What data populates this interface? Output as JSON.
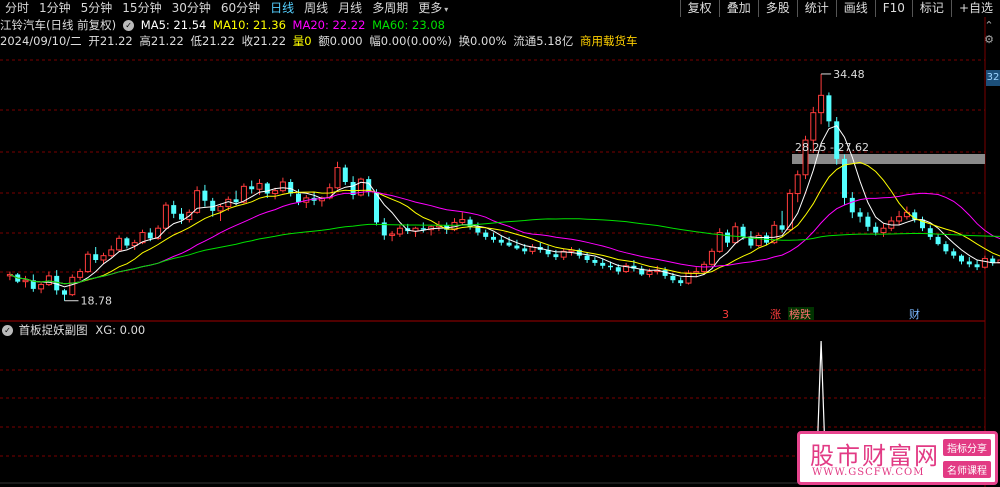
{
  "toolbar": {
    "timeframes": [
      "分时",
      "1分钟",
      "5分钟",
      "15分钟",
      "30分钟",
      "60分钟",
      "日线",
      "周线",
      "月线",
      "多周期",
      "更多"
    ],
    "active": "日线",
    "right_buttons": [
      "复权",
      "叠加",
      "多股",
      "统计",
      "画线",
      "F10",
      "标记",
      "+自选"
    ]
  },
  "header": {
    "stock_name": "江铃汽车(日线 前复权)",
    "ma5": "MA5: 21.54",
    "ma10": "MA10: 21.36",
    "ma20": "MA20: 22.22",
    "ma60": "MA60: 23.08",
    "date": "2024/09/10/二",
    "open": "开21.22",
    "high": "高21.22",
    "low": "低21.22",
    "close": "收21.22",
    "volume": "量0",
    "amount": "额0.000",
    "change": "幅0.00(0.00%)",
    "turnover": "换0.00%",
    "float": "流通5.18亿",
    "sector": "商用载货车"
  },
  "indicator": {
    "name": "首板捉妖副图",
    "xg": "XG: 0.00"
  },
  "annotations": {
    "high_label": "34.48",
    "low_label": "18.78",
    "range_label": "28.25 - 27.62",
    "price_tag": "32",
    "events": [
      "3",
      "涨",
      "榜跌",
      "财"
    ]
  },
  "watermark": {
    "name": "股市财富网",
    "url": "WWW.GSCFW.COM",
    "badge1": "指标分享",
    "badge2": "名师课程"
  },
  "colors": {
    "up": "#ff3c3c",
    "down": "#54ffff",
    "ma5": "#ffffff",
    "ma10": "#ffff00",
    "ma20": "#ff00ff",
    "ma60": "#00e000",
    "grid": "#7a0000",
    "indicator_line": "#ffffff"
  },
  "chart_data": {
    "type": "candlestick",
    "price_range": [
      18.0,
      36.0
    ],
    "candles": [
      [
        20.5,
        20.8,
        20.2,
        20.6
      ],
      [
        20.6,
        20.7,
        20.0,
        20.1
      ],
      [
        20.1,
        20.5,
        19.7,
        20.2
      ],
      [
        20.2,
        20.6,
        19.4,
        19.6
      ],
      [
        19.6,
        20.1,
        19.3,
        19.9
      ],
      [
        19.9,
        20.8,
        19.8,
        20.5
      ],
      [
        20.5,
        20.9,
        19.2,
        19.5
      ],
      [
        19.5,
        19.6,
        18.78,
        19.2
      ],
      [
        19.2,
        20.6,
        19.1,
        20.4
      ],
      [
        20.4,
        21.0,
        20.2,
        20.8
      ],
      [
        20.8,
        22.2,
        20.7,
        22.0
      ],
      [
        22.0,
        22.5,
        21.4,
        21.6
      ],
      [
        21.6,
        22.1,
        21.3,
        21.9
      ],
      [
        21.9,
        22.6,
        21.8,
        22.3
      ],
      [
        22.3,
        23.3,
        22.2,
        23.1
      ],
      [
        23.1,
        23.2,
        22.4,
        22.6
      ],
      [
        22.6,
        23.0,
        22.3,
        22.8
      ],
      [
        22.8,
        23.7,
        22.7,
        23.5
      ],
      [
        23.5,
        23.8,
        22.9,
        23.1
      ],
      [
        23.1,
        24.0,
        23.0,
        23.8
      ],
      [
        23.8,
        25.6,
        23.7,
        25.4
      ],
      [
        25.4,
        25.7,
        24.5,
        24.8
      ],
      [
        24.8,
        25.2,
        24.1,
        24.4
      ],
      [
        24.4,
        25.1,
        24.2,
        24.9
      ],
      [
        24.9,
        26.7,
        24.8,
        26.4
      ],
      [
        26.4,
        26.8,
        25.3,
        25.7
      ],
      [
        25.7,
        25.9,
        24.6,
        25.0
      ],
      [
        25.0,
        25.5,
        24.3,
        25.3
      ],
      [
        25.3,
        26.0,
        25.0,
        25.8
      ],
      [
        25.8,
        26.4,
        25.4,
        25.6
      ],
      [
        25.6,
        26.9,
        25.5,
        26.7
      ],
      [
        26.7,
        27.1,
        26.2,
        26.5
      ],
      [
        26.5,
        27.2,
        26.1,
        26.9
      ],
      [
        26.9,
        27.0,
        25.9,
        26.2
      ],
      [
        26.2,
        26.6,
        25.8,
        26.4
      ],
      [
        26.4,
        27.3,
        26.3,
        27.0
      ],
      [
        27.0,
        27.2,
        26.0,
        26.2
      ],
      [
        26.2,
        26.5,
        25.4,
        25.6
      ],
      [
        25.6,
        26.1,
        25.2,
        25.9
      ],
      [
        25.9,
        26.3,
        25.4,
        25.7
      ],
      [
        25.7,
        26.0,
        25.3,
        25.9
      ],
      [
        25.9,
        26.9,
        25.8,
        26.6
      ],
      [
        26.6,
        28.4,
        26.5,
        28.0
      ],
      [
        28.0,
        28.2,
        26.8,
        27.0
      ],
      [
        27.0,
        27.4,
        25.8,
        26.1
      ],
      [
        26.1,
        27.3,
        26.0,
        27.2
      ],
      [
        27.2,
        27.4,
        26.0,
        26.3
      ],
      [
        26.3,
        26.5,
        24.0,
        24.2
      ],
      [
        24.2,
        24.5,
        23.0,
        23.3
      ],
      [
        23.3,
        23.6,
        22.9,
        23.4
      ],
      [
        23.4,
        24.0,
        23.2,
        23.8
      ],
      [
        23.8,
        24.1,
        23.4,
        23.6
      ],
      [
        23.6,
        23.9,
        23.2,
        23.8
      ],
      [
        23.8,
        24.2,
        23.5,
        23.7
      ],
      [
        23.7,
        24.0,
        23.3,
        23.9
      ],
      [
        23.9,
        24.3,
        23.6,
        24.0
      ],
      [
        24.0,
        24.2,
        23.4,
        23.7
      ],
      [
        23.7,
        24.5,
        23.6,
        24.2
      ],
      [
        24.2,
        24.9,
        24.0,
        24.4
      ],
      [
        24.4,
        24.6,
        23.7,
        23.9
      ],
      [
        23.9,
        24.2,
        23.3,
        23.5
      ],
      [
        23.5,
        23.7,
        23.0,
        23.2
      ],
      [
        23.2,
        23.5,
        22.8,
        23.0
      ],
      [
        23.0,
        23.3,
        22.6,
        22.8
      ],
      [
        22.8,
        23.2,
        22.5,
        22.6
      ],
      [
        22.6,
        23.0,
        22.3,
        22.4
      ],
      [
        22.4,
        22.7,
        22.0,
        22.2
      ],
      [
        22.2,
        22.7,
        22.0,
        22.5
      ],
      [
        22.5,
        22.8,
        22.1,
        22.3
      ],
      [
        22.3,
        22.6,
        21.8,
        22.0
      ],
      [
        22.0,
        22.3,
        21.6,
        21.8
      ],
      [
        21.8,
        22.4,
        21.6,
        22.2
      ],
      [
        22.2,
        22.5,
        21.9,
        22.3
      ],
      [
        22.3,
        22.4,
        21.7,
        21.9
      ],
      [
        21.9,
        22.1,
        21.4,
        21.6
      ],
      [
        21.6,
        21.8,
        21.2,
        21.4
      ],
      [
        21.4,
        21.7,
        21.0,
        21.2
      ],
      [
        21.2,
        21.5,
        20.9,
        21.1
      ],
      [
        21.1,
        21.3,
        20.6,
        20.8
      ],
      [
        20.8,
        21.4,
        20.7,
        21.2
      ],
      [
        21.2,
        21.6,
        20.8,
        21.0
      ],
      [
        21.0,
        21.2,
        20.5,
        20.6
      ],
      [
        20.6,
        21.0,
        20.4,
        20.8
      ],
      [
        20.8,
        21.2,
        20.6,
        20.9
      ],
      [
        20.9,
        21.1,
        20.3,
        20.5
      ],
      [
        20.5,
        20.7,
        20.0,
        20.2
      ],
      [
        20.2,
        20.4,
        19.8,
        20.0
      ],
      [
        20.0,
        20.9,
        19.9,
        20.7
      ],
      [
        20.7,
        21.1,
        20.4,
        20.8
      ],
      [
        20.8,
        21.5,
        20.7,
        21.3
      ],
      [
        21.3,
        22.4,
        21.2,
        22.2
      ],
      [
        22.2,
        23.8,
        22.1,
        23.5
      ],
      [
        23.5,
        23.7,
        22.5,
        22.8
      ],
      [
        22.8,
        24.2,
        22.7,
        23.9
      ],
      [
        23.9,
        24.1,
        23.0,
        23.2
      ],
      [
        23.2,
        23.6,
        22.4,
        22.6
      ],
      [
        22.6,
        23.5,
        22.5,
        23.3
      ],
      [
        23.3,
        23.5,
        22.6,
        22.8
      ],
      [
        22.8,
        24.3,
        22.7,
        24.0
      ],
      [
        24.0,
        25.0,
        23.5,
        23.7
      ],
      [
        23.7,
        26.5,
        23.6,
        26.2
      ],
      [
        26.2,
        27.8,
        25.6,
        27.5
      ],
      [
        27.5,
        30.2,
        27.2,
        29.9
      ],
      [
        29.9,
        32.2,
        29.0,
        31.8
      ],
      [
        31.8,
        34.48,
        31.0,
        33.0
      ],
      [
        33.0,
        33.2,
        30.8,
        31.2
      ],
      [
        31.2,
        31.5,
        28.2,
        28.6
      ],
      [
        28.6,
        28.9,
        25.4,
        25.9
      ],
      [
        25.9,
        26.3,
        24.5,
        24.9
      ],
      [
        24.9,
        25.2,
        24.2,
        24.6
      ],
      [
        24.6,
        24.9,
        23.6,
        23.9
      ],
      [
        23.9,
        24.2,
        23.3,
        23.5
      ],
      [
        23.5,
        24.1,
        23.2,
        23.8
      ],
      [
        23.8,
        24.6,
        23.6,
        24.3
      ],
      [
        24.3,
        25.0,
        24.0,
        24.6
      ],
      [
        24.6,
        25.3,
        24.4,
        24.9
      ],
      [
        24.9,
        25.1,
        24.2,
        24.4
      ],
      [
        24.4,
        24.6,
        23.6,
        23.8
      ],
      [
        23.8,
        24.0,
        23.0,
        23.2
      ],
      [
        23.2,
        23.4,
        22.6,
        22.7
      ],
      [
        22.7,
        22.9,
        22.0,
        22.2
      ],
      [
        22.2,
        22.4,
        21.7,
        21.9
      ],
      [
        21.9,
        22.0,
        21.3,
        21.5
      ],
      [
        21.5,
        21.8,
        21.1,
        21.3
      ],
      [
        21.3,
        21.6,
        20.9,
        21.1
      ],
      [
        21.1,
        21.9,
        21.0,
        21.7
      ],
      [
        21.7,
        21.9,
        21.2,
        21.4
      ],
      [
        21.4,
        22.0,
        21.2,
        21.6
      ],
      [
        21.6,
        23.0,
        21.5,
        21.8
      ],
      [
        21.8,
        21.9,
        21.1,
        21.22
      ]
    ],
    "indicator_peak_index": 104
  }
}
